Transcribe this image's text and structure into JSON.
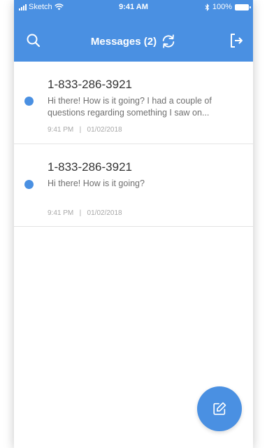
{
  "status_bar": {
    "carrier": "Sketch",
    "time": "9:41 AM",
    "battery": "100%"
  },
  "header": {
    "title": "Messages (2)",
    "icons": [
      "search-icon",
      "refresh-icon",
      "logout-icon"
    ]
  },
  "messages": [
    {
      "phone": "1-833-286-3921",
      "preview": "Hi there! How is it going? I had a couple of questions regarding something I saw on...",
      "time": "9:41 PM",
      "separator": "|",
      "date": "01/02/2018",
      "unread": true
    },
    {
      "phone": "1-833-286-3921",
      "preview": "Hi there! How is it going?",
      "time": "9:41 PM",
      "separator": "|",
      "date": "01/02/2018",
      "unread": true
    }
  ],
  "fab": {
    "icon": "compose-icon"
  },
  "colors": {
    "accent": "#4a90e2",
    "text_primary": "#333333",
    "text_secondary": "#6f6f6f",
    "text_meta": "#a8a8a8"
  }
}
